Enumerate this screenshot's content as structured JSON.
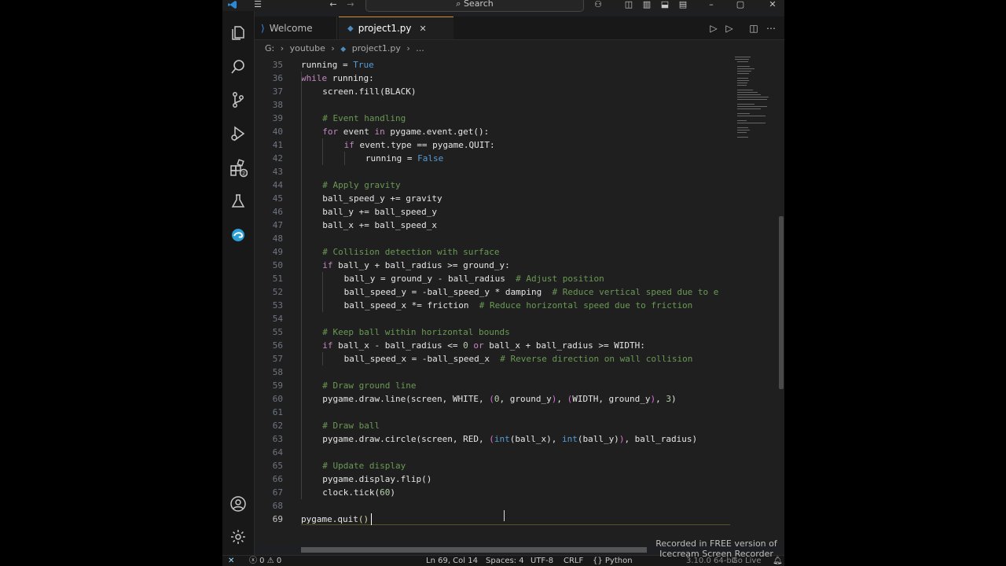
{
  "titlebar": {
    "search_placeholder": "Search"
  },
  "tabs": [
    {
      "label": "Welcome"
    },
    {
      "label": "project1.py"
    }
  ],
  "breadcrumb": [
    "G:",
    "youtube",
    "project1.py",
    "..."
  ],
  "editor": {
    "lines": [
      {
        "n": "35",
        "indent": 0,
        "html": "running = <span class=\"bi\">True</span>"
      },
      {
        "n": "36",
        "indent": 0,
        "html": "<span class=\"kw\">while</span> running:"
      },
      {
        "n": "37",
        "indent": 1,
        "html": "screen.fill(BLACK)"
      },
      {
        "n": "38",
        "indent": 0,
        "html": ""
      },
      {
        "n": "39",
        "indent": 1,
        "html": "<span class=\"cm\"># Event handling</span>"
      },
      {
        "n": "40",
        "indent": 1,
        "html": "<span class=\"kw\">for</span> event <span class=\"kw\">in</span> pygame.event.get():"
      },
      {
        "n": "41",
        "indent": 2,
        "html": "<span class=\"kw\">if</span> event.type == pygame.QUIT:"
      },
      {
        "n": "42",
        "indent": 3,
        "html": "running = <span class=\"bi\">False</span>"
      },
      {
        "n": "43",
        "indent": 0,
        "html": ""
      },
      {
        "n": "44",
        "indent": 1,
        "html": "<span class=\"cm\"># Apply gravity</span>"
      },
      {
        "n": "45",
        "indent": 1,
        "html": "ball_speed_y += gravity"
      },
      {
        "n": "46",
        "indent": 1,
        "html": "ball_y += ball_speed_y"
      },
      {
        "n": "47",
        "indent": 1,
        "html": "ball_x += ball_speed_x"
      },
      {
        "n": "48",
        "indent": 0,
        "html": ""
      },
      {
        "n": "49",
        "indent": 1,
        "html": "<span class=\"cm\"># Collision detection with surface</span>"
      },
      {
        "n": "50",
        "indent": 1,
        "html": "<span class=\"kw\">if</span> ball_y + ball_radius &gt;= ground_y:"
      },
      {
        "n": "51",
        "indent": 2,
        "html": "ball_y = ground_y - ball_radius  <span class=\"cm\"># Adjust position</span>"
      },
      {
        "n": "52",
        "indent": 2,
        "html": "ball_speed_y = -ball_speed_y * damping  <span class=\"cm\"># Reduce vertical speed due to e</span>"
      },
      {
        "n": "53",
        "indent": 2,
        "html": "ball_speed_x *= friction  <span class=\"cm\"># Reduce horizontal speed due to friction</span>"
      },
      {
        "n": "54",
        "indent": 0,
        "html": ""
      },
      {
        "n": "55",
        "indent": 1,
        "html": "<span class=\"cm\"># Keep ball within horizontal bounds</span>"
      },
      {
        "n": "56",
        "indent": 1,
        "html": "<span class=\"kw\">if</span> ball_x - ball_radius &lt;= <span class=\"nm\">0</span> <span class=\"kw\">or</span> ball_x + ball_radius &gt;= WIDTH:"
      },
      {
        "n": "57",
        "indent": 2,
        "html": "ball_speed_x = -ball_speed_x  <span class=\"cm\"># Reverse direction on wall collision</span>"
      },
      {
        "n": "58",
        "indent": 0,
        "html": ""
      },
      {
        "n": "59",
        "indent": 1,
        "html": "<span class=\"cm\"># Draw ground line</span>"
      },
      {
        "n": "60",
        "indent": 1,
        "html": "pygame.draw.line(screen, WHITE, <span class=\"br\">(</span><span class=\"nm\">0</span>, ground_y<span class=\"br\">)</span>, <span class=\"br\">(</span>WIDTH, ground_y<span class=\"br\">)</span>, <span class=\"nm\">3</span>)"
      },
      {
        "n": "61",
        "indent": 0,
        "html": ""
      },
      {
        "n": "62",
        "indent": 1,
        "html": "<span class=\"cm\"># Draw ball</span>"
      },
      {
        "n": "63",
        "indent": 1,
        "html": "pygame.draw.circle(screen, RED, <span class=\"br\">(</span><span class=\"bi\">int</span>(ball_x), <span class=\"bi\">int</span>(ball_y)<span class=\"br\">)</span>, ball_radius)"
      },
      {
        "n": "64",
        "indent": 0,
        "html": ""
      },
      {
        "n": "65",
        "indent": 1,
        "html": "<span class=\"cm\"># Update display</span>"
      },
      {
        "n": "66",
        "indent": 1,
        "html": "pygame.display.flip()"
      },
      {
        "n": "67",
        "indent": 1,
        "html": "clock.tick(<span class=\"nm\">60</span>)"
      },
      {
        "n": "68",
        "indent": 0,
        "html": ""
      },
      {
        "n": "69",
        "indent": 0,
        "html": "pygame.quit<span class=\"fn\">()</span>"
      }
    ]
  },
  "statusbar": {
    "remote": "✕",
    "problems": "ⓧ 0 ⚠ 0",
    "position": "Ln 69, Col 14",
    "spaces": "Spaces: 4",
    "encoding": "UTF-8",
    "eol": "CRLF",
    "language": "{} Python",
    "interpreter": "3.10.0 64-bit",
    "golive": "Go Live"
  },
  "watermark": {
    "line1": "Recorded in FREE version of",
    "line2": "Icecream Screen Recorder"
  },
  "colors": {
    "editor_bg": "#1f1f1f",
    "activitybar_bg": "#181818",
    "keyword": "#c586c0",
    "comment": "#6a9955",
    "number": "#b5cea8",
    "tab_accent": "#d98a2b"
  }
}
